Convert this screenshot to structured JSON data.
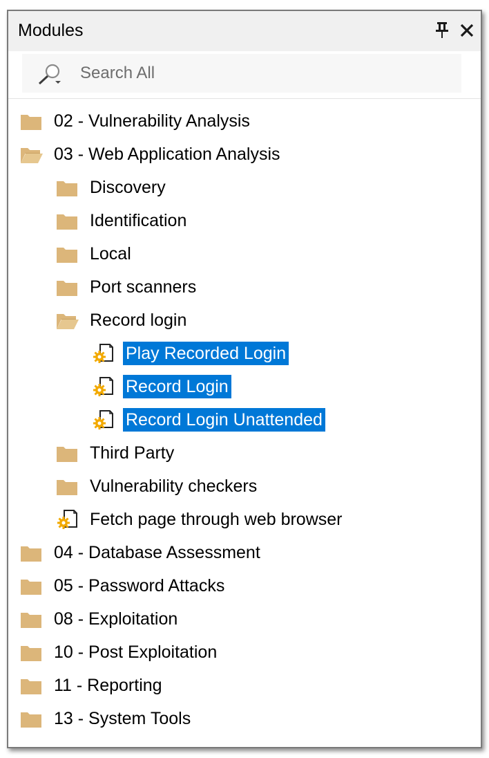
{
  "panel": {
    "title": "Modules",
    "pin_glyph": "pin-icon",
    "close_glyph": "close-icon"
  },
  "search": {
    "placeholder": "Search All",
    "value": ""
  },
  "colors": {
    "folder": "#dcb67a",
    "selection": "#0078d7",
    "gear": "#f2a900"
  },
  "tree": [
    {
      "label": "02 - Vulnerability Analysis",
      "level": 0,
      "kind": "folder",
      "expanded": false,
      "selected": false
    },
    {
      "label": "03 - Web Application Analysis",
      "level": 0,
      "kind": "folder",
      "expanded": true,
      "selected": false
    },
    {
      "label": "Discovery",
      "level": 1,
      "kind": "folder",
      "expanded": false,
      "selected": false
    },
    {
      "label": "Identification",
      "level": 1,
      "kind": "folder",
      "expanded": false,
      "selected": false
    },
    {
      "label": "Local",
      "level": 1,
      "kind": "folder",
      "expanded": false,
      "selected": false
    },
    {
      "label": "Port scanners",
      "level": 1,
      "kind": "folder",
      "expanded": false,
      "selected": false
    },
    {
      "label": "Record login",
      "level": 1,
      "kind": "folder",
      "expanded": true,
      "selected": false
    },
    {
      "label": "Play Recorded Login",
      "level": 2,
      "kind": "module",
      "expanded": false,
      "selected": true
    },
    {
      "label": "Record Login",
      "level": 2,
      "kind": "module",
      "expanded": false,
      "selected": true
    },
    {
      "label": "Record Login Unattended",
      "level": 2,
      "kind": "module",
      "expanded": false,
      "selected": true
    },
    {
      "label": "Third Party",
      "level": 1,
      "kind": "folder",
      "expanded": false,
      "selected": false
    },
    {
      "label": "Vulnerability checkers",
      "level": 1,
      "kind": "folder",
      "expanded": false,
      "selected": false
    },
    {
      "label": "Fetch page through web browser",
      "level": 1,
      "kind": "module",
      "expanded": false,
      "selected": false
    },
    {
      "label": "04 - Database Assessment",
      "level": 0,
      "kind": "folder",
      "expanded": false,
      "selected": false
    },
    {
      "label": "05 - Password Attacks",
      "level": 0,
      "kind": "folder",
      "expanded": false,
      "selected": false
    },
    {
      "label": "08 - Exploitation",
      "level": 0,
      "kind": "folder",
      "expanded": false,
      "selected": false
    },
    {
      "label": "10 - Post Exploitation",
      "level": 0,
      "kind": "folder",
      "expanded": false,
      "selected": false
    },
    {
      "label": "11 - Reporting",
      "level": 0,
      "kind": "folder",
      "expanded": false,
      "selected": false
    },
    {
      "label": "13 - System Tools",
      "level": 0,
      "kind": "folder",
      "expanded": false,
      "selected": false
    }
  ]
}
